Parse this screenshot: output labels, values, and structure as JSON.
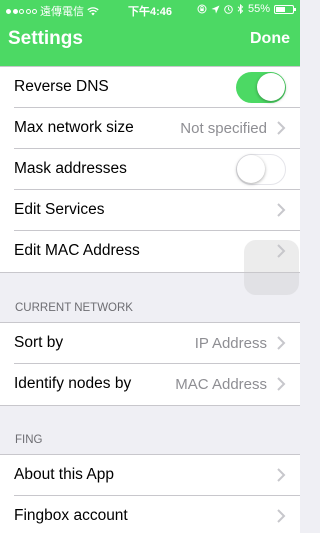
{
  "status_bar": {
    "carrier": "遠傳電信",
    "time": "下午4:46",
    "battery_text": "55%",
    "battery_level": 0.55,
    "signal_bars": 2
  },
  "nav": {
    "title": "Settings",
    "done_label": "Done",
    "accent_color": "#4cd964"
  },
  "top_group": {
    "reverse_dns": {
      "label": "Reverse DNS",
      "enabled": true
    },
    "max_network_size": {
      "label": "Max network size",
      "value": "Not specified"
    },
    "mask_addresses": {
      "label": "Mask addresses",
      "enabled": false
    },
    "edit_services": {
      "label": "Edit Services"
    },
    "edit_mac": {
      "label": "Edit MAC Address"
    }
  },
  "current_network": {
    "header": "CURRENT NETWORK",
    "sort_by": {
      "label": "Sort by",
      "value": "IP Address"
    },
    "identify_nodes": {
      "label": "Identify nodes by",
      "value": "MAC Address"
    }
  },
  "fing": {
    "header": "FING",
    "about": {
      "label": "About this App"
    },
    "fingbox": {
      "label": "Fingbox account"
    }
  }
}
